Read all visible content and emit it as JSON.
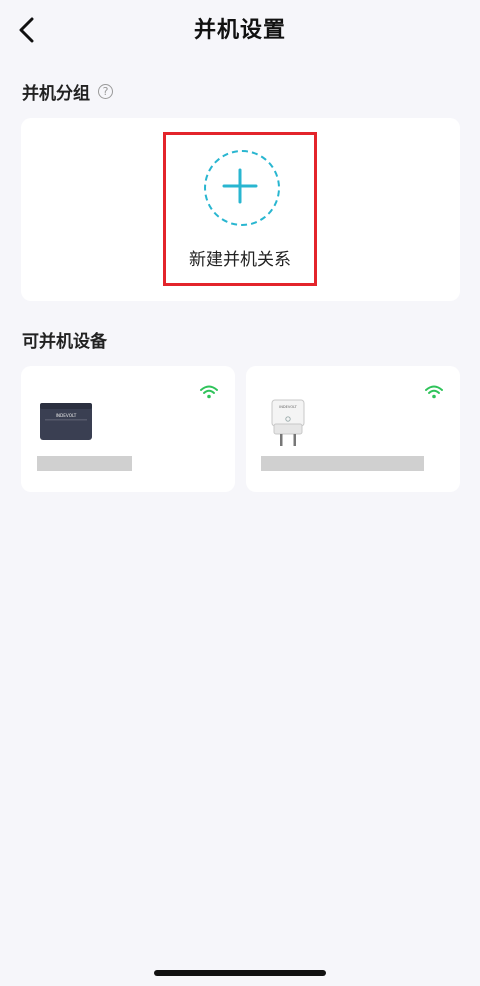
{
  "header": {
    "title": "并机设置"
  },
  "group_section": {
    "title": "并机分组",
    "help_glyph": "?",
    "new_relation_label": "新建并机关系",
    "accent_color": "#29b6d0",
    "highlight_color": "#e3242b"
  },
  "devices_section": {
    "title": "可并机设备",
    "devices": [
      {
        "icon": "power-station",
        "wifi": "connected",
        "brand_text": "INDEVOLT"
      },
      {
        "icon": "smart-plug",
        "wifi": "connected",
        "brand_text": "INDEVOLT"
      }
    ],
    "wifi_color": "#2fc35a"
  }
}
